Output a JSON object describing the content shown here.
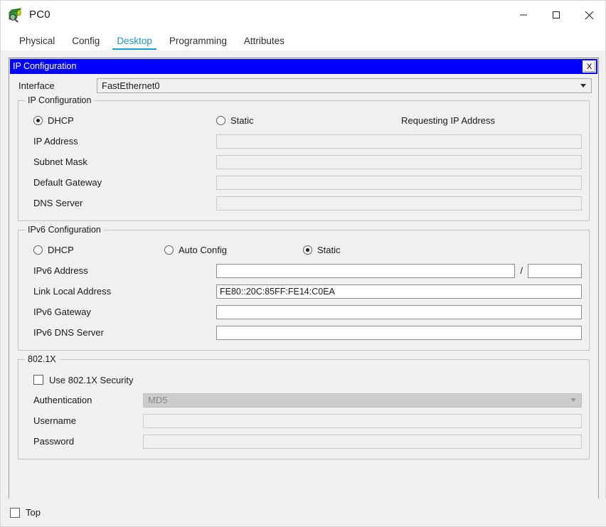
{
  "window": {
    "title": "PC0",
    "icon": "packet-tracer-device-icon",
    "controls": {
      "minimize": "minimize-icon",
      "maximize": "maximize-icon",
      "close": "close-icon"
    }
  },
  "tabs": [
    {
      "label": "Physical",
      "active": false
    },
    {
      "label": "Config",
      "active": false
    },
    {
      "label": "Desktop",
      "active": true
    },
    {
      "label": "Programming",
      "active": false
    },
    {
      "label": "Attributes",
      "active": false
    }
  ],
  "colors": {
    "tab_active": "#1b9cc9",
    "inner_titlebar": "#0000ff",
    "inner_titlebar_text": "#ffffff",
    "window_bg": "#f0f0f0"
  },
  "ip_config_window": {
    "title": "IP Configuration",
    "close_label": "X"
  },
  "interface": {
    "label": "Interface",
    "value": "FastEthernet0",
    "options": [
      "FastEthernet0"
    ]
  },
  "ipv4_group": {
    "legend": "IP Configuration",
    "modes": [
      {
        "label": "DHCP",
        "selected": true
      },
      {
        "label": "Static",
        "selected": false
      }
    ],
    "status": "Requesting IP Address",
    "fields": [
      {
        "label": "IP Address",
        "value": "",
        "enabled": false
      },
      {
        "label": "Subnet Mask",
        "value": "",
        "enabled": false
      },
      {
        "label": "Default Gateway",
        "value": "",
        "enabled": false
      },
      {
        "label": "DNS Server",
        "value": "",
        "enabled": false
      }
    ]
  },
  "ipv6_group": {
    "legend": "IPv6 Configuration",
    "modes": [
      {
        "label": "DHCP",
        "selected": false
      },
      {
        "label": "Auto Config",
        "selected": false
      },
      {
        "label": "Static",
        "selected": true
      }
    ],
    "address_label": "IPv6 Address",
    "address_value": "",
    "prefix_separator": "/",
    "prefix_value": "",
    "fields": [
      {
        "label": "Link Local Address",
        "value": "FE80::20C:85FF:FE14:C0EA"
      },
      {
        "label": "IPv6 Gateway",
        "value": ""
      },
      {
        "label": "IPv6 DNS Server",
        "value": ""
      }
    ]
  },
  "dot1x_group": {
    "legend": "802.1X",
    "checkbox_label": "Use 802.1X Security",
    "checkbox_checked": false,
    "authentication": {
      "label": "Authentication",
      "value": "MD5",
      "enabled": false,
      "options": [
        "MD5"
      ]
    },
    "username": {
      "label": "Username",
      "value": ""
    },
    "password": {
      "label": "Password",
      "value": ""
    }
  },
  "bottom": {
    "top_checkbox_label": "Top",
    "top_checkbox_checked": false
  }
}
